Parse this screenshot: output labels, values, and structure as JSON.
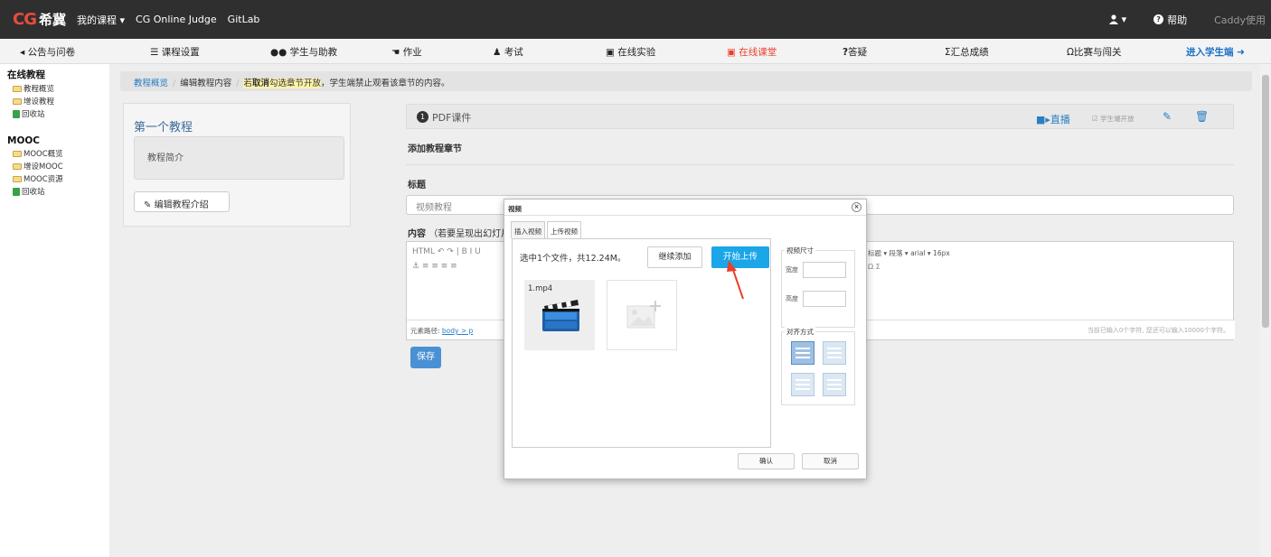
{
  "navbar": {
    "logo_cg": "CG",
    "logo_name": "希冀",
    "links": [
      "我的课程 ▾",
      "CG Online Judge",
      "GitLab"
    ],
    "help": "帮助",
    "user": "Caddy使用"
  },
  "menubar": {
    "items": [
      "公告与问卷",
      "课程设置",
      "学生与助教",
      "作业",
      "考试",
      "在线实验",
      "在线课堂",
      "答疑",
      "汇总成绩",
      "比赛与闯关"
    ],
    "icons": [
      "bullhorn-icon",
      "list-icon",
      "users-icon",
      "hand-icon",
      "exam-icon",
      "monitor-icon",
      "video-icon",
      "question-icon",
      "sigma-icon",
      "trophy-icon"
    ],
    "active_index": 6,
    "student_mode": "进入学生端"
  },
  "sidebar": {
    "section1": "在线教程",
    "section1_items": [
      "教程概览",
      "增设教程",
      "回收站"
    ],
    "section2": "MOOC",
    "section2_items": [
      "MOOC概览",
      "增设MOOC",
      "MOOC资源",
      "回收站"
    ]
  },
  "breadcrumb": {
    "crumb1": "教程概览",
    "crumb2": "编辑教程内容",
    "warn_prefix": "若",
    "warn_bold": "取消",
    "warn_suffix": "勾选章节开放",
    "tail": "，学生端禁止观看该章节的内容。"
  },
  "left_panel": {
    "title": "第一个教程",
    "intro": "教程简介",
    "edit_button": "编辑教程介绍"
  },
  "chapter": {
    "number": "1",
    "title": "PDF课件",
    "live": "直播",
    "student_open": "学生端开放",
    "add_chapter": "添加教程章节",
    "title_label": "标题",
    "title_value": "视频教程",
    "content_label": "内容",
    "content_hint": "（若要呈现出幻灯片",
    "toolbar_row1": "HTML  ↶  ↷  |  B  I  U",
    "toolbar_row2": "⚓  ≡  ≡  ≡  ≡",
    "toolbar_right1": "标题 ▾  段落     ▾ arial        ▾ 16px",
    "toolbar_right2": "Ω  Σ",
    "path_label": "元素路径:",
    "path_value": "body > p",
    "wordcount": "当前已输入0个字符, 您还可以输入10000个字符。",
    "save": "保存"
  },
  "modal": {
    "title": "视频",
    "close": "×",
    "tabs": [
      "插入视频",
      "上传视频"
    ],
    "active_tab": 1,
    "status": "选中1个文件，共12.24M。",
    "continue_add": "继续添加",
    "start_upload": "开始上传",
    "file_name": "1.mp4",
    "size_legend": "视频尺寸",
    "width_label": "宽度",
    "height_label": "高度",
    "width_value": "",
    "height_value": "",
    "align_legend": "对齐方式",
    "ok": "确认",
    "cancel": "取消"
  },
  "colors": {
    "navbar": "#2f2f2f",
    "accent": "#1ba6e8",
    "active_menu": "#e8412d",
    "link": "#2a7ec4",
    "arrow": "#e8412d"
  }
}
